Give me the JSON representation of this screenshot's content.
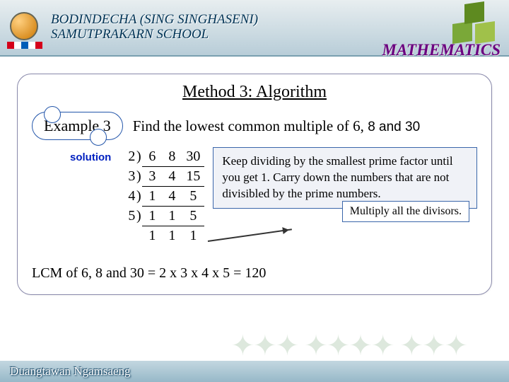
{
  "header": {
    "school_line1": "BODINDECHA (SING SINGHASENI)",
    "school_line2": "SAMUTPRAKARN  SCHOOL",
    "subject": "MATHEMATICS"
  },
  "panel": {
    "method_title": "Method 3: Algorithm",
    "example_label": "Example 3",
    "problem_pre": "Find the lowest common multiple of 6, ",
    "problem_mid": "8 and  30",
    "solution_label": "solution",
    "algo": {
      "rows": [
        {
          "divisor": "2",
          "a": "6",
          "b": "8",
          "c": "30"
        },
        {
          "divisor": "3",
          "a": "3",
          "b": "4",
          "c": "15"
        },
        {
          "divisor": "4",
          "a": "1",
          "b": "4",
          "c": "5"
        },
        {
          "divisor": "5",
          "a": "1",
          "b": "1",
          "c": "5"
        }
      ],
      "final": {
        "a": "1",
        "b": "1",
        "c": "1"
      }
    },
    "explain_main": "Keep dividing by the smallest prime factor until you get 1. Carry down the numbers that are not divisibled by the prime numbers.",
    "explain_sub": "Multiply all the divisors.",
    "result_text": "LCM of  6, 8 and 30 = 2 x 3 x 4 x 5 = 120"
  },
  "footer": {
    "author": "Duangtawan  Ngamsaeng"
  }
}
